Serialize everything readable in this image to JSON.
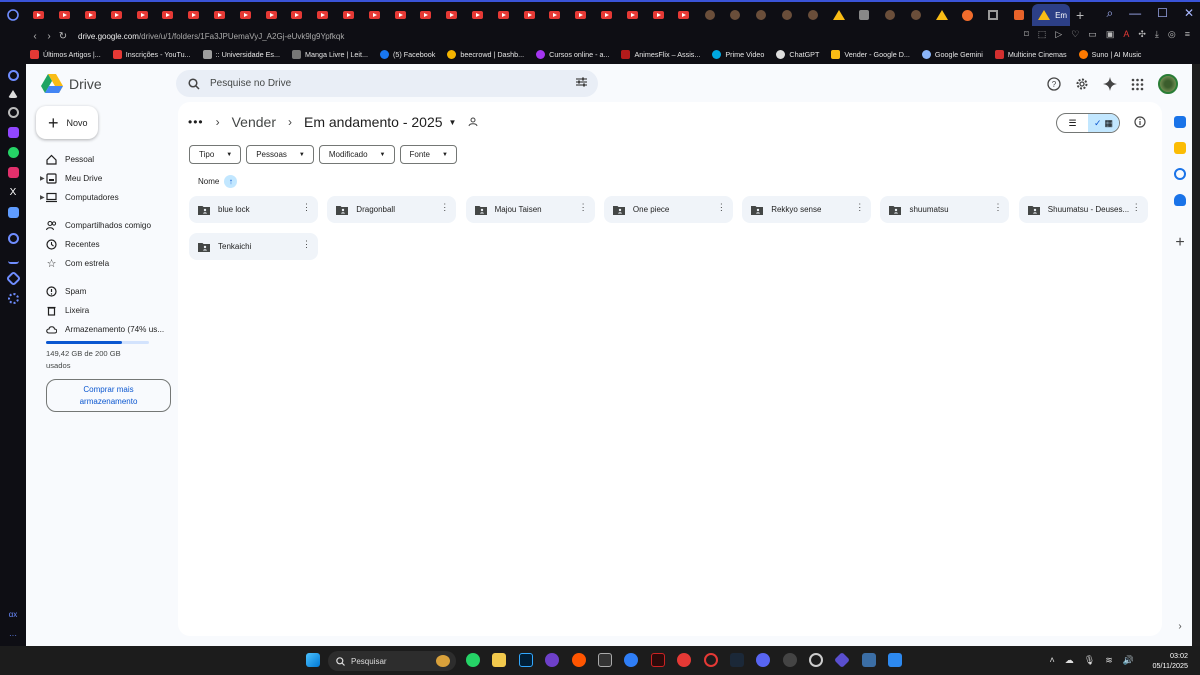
{
  "browser": {
    "active_tab_title": "Em",
    "url_host": "drive.google.com",
    "url_path": "/drive/u/1/folders/1Fa3JPUemaVyJ_A2Gj-eUvk9lg9Ypfkqk",
    "bookmarks": [
      {
        "label": "Últimos Artigos |...",
        "color": "#e53935"
      },
      {
        "label": "Inscrições - YouTu...",
        "color": "#e53935"
      },
      {
        "label": ":: Universidade Es...",
        "color": "#9e9e9e"
      },
      {
        "label": "Manga Livre | Leit...",
        "color": "#777777"
      },
      {
        "label": "(5) Facebook",
        "color": "#1877f2"
      },
      {
        "label": "beecrowd | Dashb...",
        "color": "#f4b400"
      },
      {
        "label": "Cursos online - a...",
        "color": "#a435f0"
      },
      {
        "label": "AnimesFlix – Assis...",
        "color": "#b31b1b"
      },
      {
        "label": "Prime Video",
        "color": "#00a8e1"
      },
      {
        "label": "ChatGPT",
        "color": "#dddddd"
      },
      {
        "label": "Vender - Google D...",
        "color": "#f9bc15"
      },
      {
        "label": "Google Gemini",
        "color": "#8ab4f8"
      },
      {
        "label": "Multicine Cinemas",
        "color": "#d32f2f"
      },
      {
        "label": "Suno | AI Music",
        "color": "#ff7a00"
      }
    ]
  },
  "drive": {
    "app_name": "Drive",
    "search_placeholder": "Pesquise no Drive",
    "new_label": "Novo",
    "nav": {
      "pessoal": "Pessoal",
      "meu_drive": "Meu Drive",
      "computadores": "Computadores",
      "compartilhados": "Compartilhados comigo",
      "recentes": "Recentes",
      "estrela": "Com estrela",
      "spam": "Spam",
      "lixeira": "Lixeira",
      "armazenamento": "Armazenamento (74% us..."
    },
    "storage": {
      "used_fraction": 0.74,
      "text": "149,42 GB de 200 GB usados"
    },
    "buy_storage": "Comprar mais armazenamento",
    "breadcrumb": {
      "parent": "Vender",
      "current": "Em andamento - 2025"
    },
    "filters": {
      "tipo": "Tipo",
      "pessoas": "Pessoas",
      "modificado": "Modificado",
      "fonte": "Fonte"
    },
    "sort_label": "Nome",
    "folders": [
      "blue lock",
      "Dragonball",
      "Majou Taisen",
      "One piece",
      "Rekkyo sense",
      "shuumatsu",
      "Shuumatsu - Deuses...",
      "Tenkaichi"
    ]
  },
  "taskbar": {
    "search_label": "Pesquisar",
    "time": "03:02",
    "date": "05/11/2025"
  }
}
